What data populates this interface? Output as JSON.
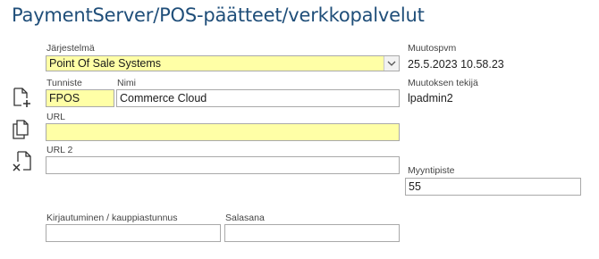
{
  "title": "PaymentServer/POS-päätteet/verkkopalvelut",
  "jarjestelma": {
    "label": "Järjestelmä",
    "value": "Point Of Sale Systems"
  },
  "tunniste": {
    "label": "Tunniste",
    "value": "FPOS"
  },
  "nimi": {
    "label": "Nimi",
    "value": "Commerce Cloud"
  },
  "url": {
    "label": "URL",
    "value": ""
  },
  "url2": {
    "label": "URL 2",
    "value": ""
  },
  "kirjautuminen": {
    "label": "Kirjautuminen / kauppiastunnus",
    "value": ""
  },
  "salasana": {
    "label": "Salasana",
    "value": ""
  },
  "muutospvm": {
    "label": "Muutospvm",
    "value": "25.5.2023 10.58.23"
  },
  "muutoksen_tekija": {
    "label": "Muutoksen tekijä",
    "value": "lpadmin2"
  },
  "myyntipiste": {
    "label": "Myyntipiste",
    "value": "55"
  },
  "icons": [
    "new-document-icon",
    "copy-icon",
    "delete-document-icon"
  ],
  "colors": {
    "title": "#1f4e79",
    "required_field": "#ffffa6"
  }
}
